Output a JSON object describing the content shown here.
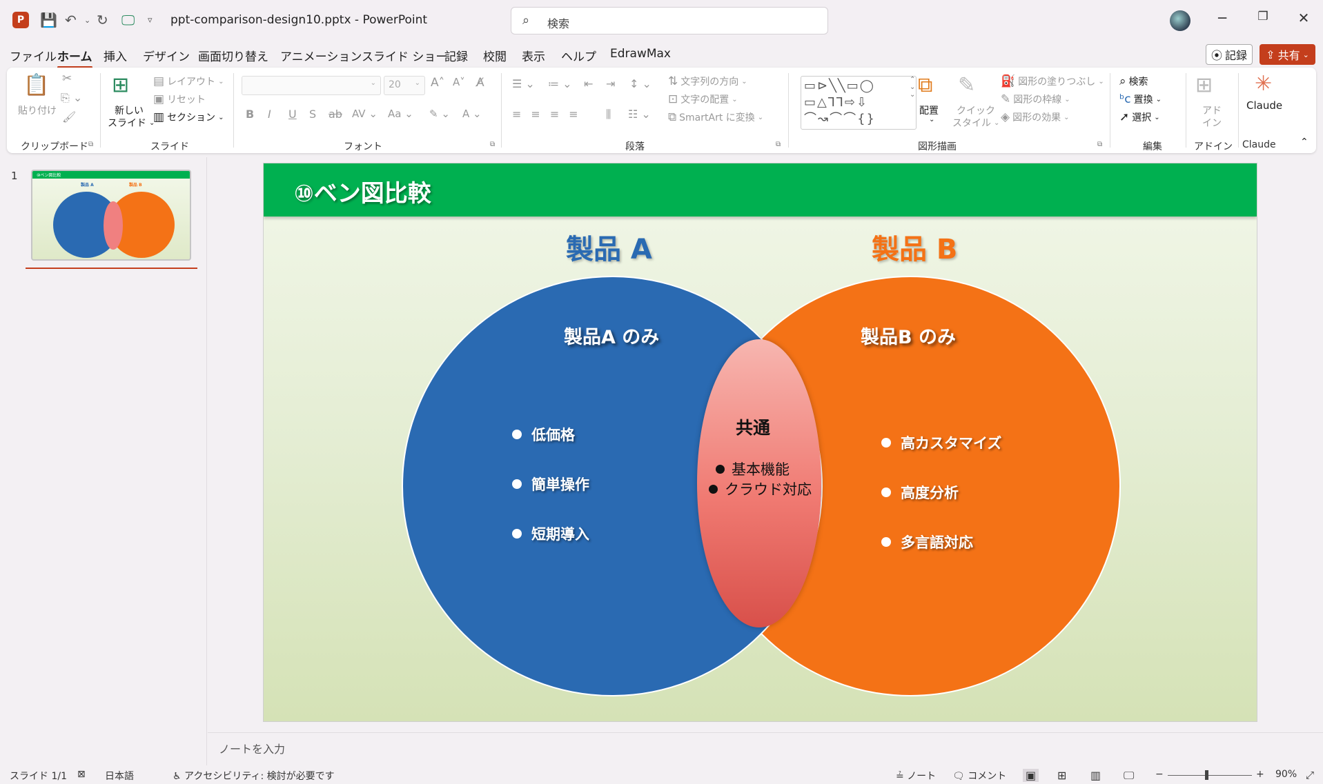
{
  "titlebar": {
    "doc_title": "ppt-comparison-design10.pptx  -  PowerPoint",
    "search_placeholder": "検索"
  },
  "menu": {
    "tabs": [
      "ファイル",
      "ホーム",
      "挿入",
      "デザイン",
      "画面切り替え",
      "アニメーション",
      "スライド ショー",
      "記録",
      "校閲",
      "表示",
      "ヘルプ",
      "EdrawMax"
    ],
    "active": "ホーム",
    "record_label": "記録",
    "share_label": "共有"
  },
  "ribbon": {
    "clipboard": {
      "paste": "貼り付け",
      "label": "クリップボード"
    },
    "slides": {
      "new_slide": "新しい",
      "new_slide2": "スライド",
      "layout": "レイアウト",
      "reset": "リセット",
      "section": "セクション",
      "label": "スライド"
    },
    "font": {
      "font_size": "20",
      "label": "フォント"
    },
    "paragraph": {
      "text_direction": "文字列の方向",
      "align_text": "文字の配置",
      "smartart": "SmartArt に変換",
      "label": "段落"
    },
    "drawing": {
      "arrange": "配置",
      "quick_style": "クイック",
      "quick_style2": "スタイル",
      "fill": "図形の塗りつぶし",
      "outline": "図形の枠線",
      "effect": "図形の効果",
      "label": "図形描画"
    },
    "editing": {
      "find": "検索",
      "replace": "置換",
      "select": "選択",
      "label": "編集"
    },
    "addins": {
      "addin": "アド",
      "addin2": "イン",
      "label": "アドイン"
    },
    "claude": {
      "button": "Claude",
      "label": "Claude"
    }
  },
  "thumbnails": {
    "number": "1",
    "title": "⑩ベン図比較",
    "a": "製品 A",
    "b": "製品 B"
  },
  "slide": {
    "title": "⑩ベン図比較",
    "product_a": "製品 A",
    "product_b": "製品 B",
    "a_only": "製品A のみ",
    "b_only": "製品B のみ",
    "a_items": [
      "低価格",
      "簡単操作",
      "短期導入"
    ],
    "b_items": [
      "高カスタマイズ",
      "高度分析",
      "多言語対応"
    ],
    "common_title": "共通",
    "common_items": [
      "基本機能",
      "クラウド対応"
    ],
    "colors": {
      "header": "#00b050",
      "product_a": "#2a6ab2",
      "product_b": "#f47216",
      "overlap": "#f07a72"
    }
  },
  "notes": {
    "placeholder": "ノートを入力"
  },
  "status": {
    "slide": "スライド 1/1",
    "language": "日本語",
    "accessibility": "アクセシビリティ: 検討が必要です",
    "notes": "ノート",
    "comments": "コメント",
    "zoom": "90%"
  }
}
